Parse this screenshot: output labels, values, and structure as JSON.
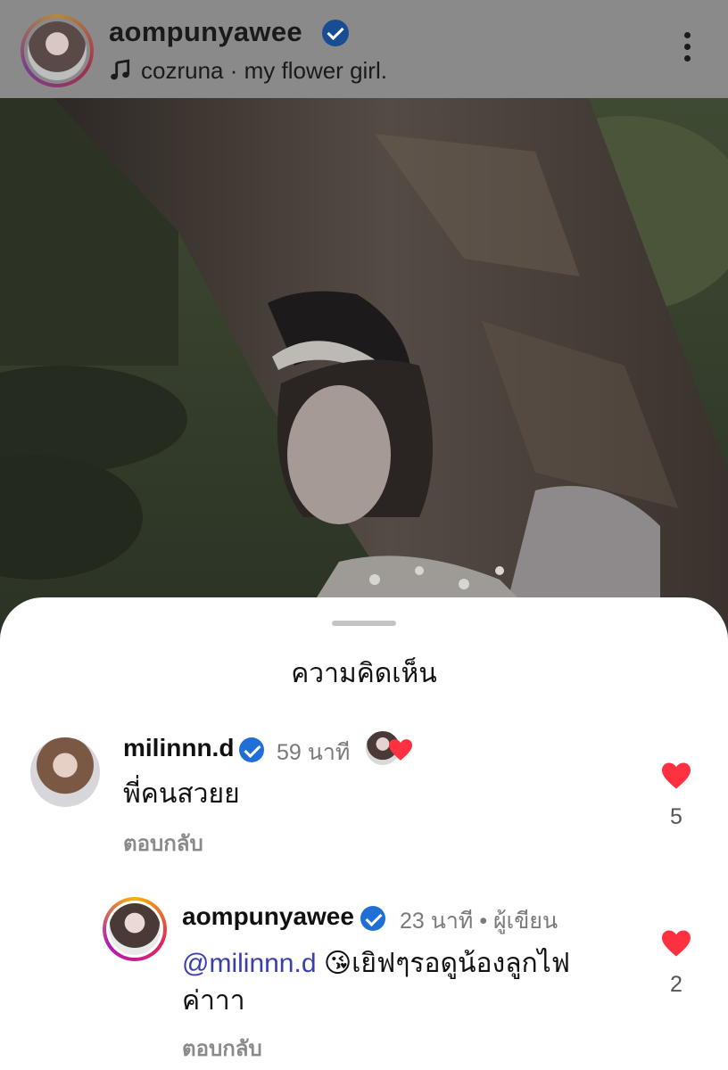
{
  "header": {
    "username": "aompunyawee",
    "music": "cozruna · my flower girl.",
    "icons": {
      "music": "music-note-icon",
      "more": "more-options-icon",
      "verified": "verified-badge-icon"
    }
  },
  "sheet": {
    "title": "ความคิดเห็น"
  },
  "comments": [
    {
      "username": "milinnn.d",
      "time": "59 นาที",
      "text": "พี่คนสวยย",
      "reply_label": "ตอบกลับ",
      "likes": "5",
      "liked": true,
      "liked_by_author": true
    },
    {
      "username": "aompunyawee",
      "time": "23 นาที",
      "author_label": "• ผู้เขียน",
      "mention": "@milinnn.d",
      "emoji": "😘",
      "text_line1": "เยิฟๆรอดูน้องลูกไฟ",
      "text_line2": "ค่าาา",
      "reply_label": "ตอบกลับ",
      "likes": "2",
      "liked": true
    }
  ],
  "colors": {
    "like_red": "#ff3040",
    "verified_blue": "#1f6fd6",
    "mention_blue": "#3b3fa8",
    "muted_text": "#7a7a7a"
  }
}
